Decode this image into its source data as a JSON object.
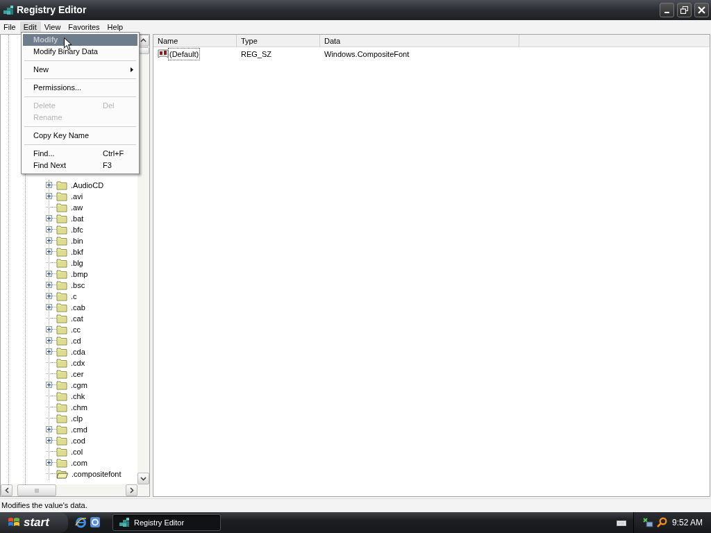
{
  "window": {
    "title": "Registry Editor"
  },
  "menu_bar": [
    {
      "label": "File",
      "open": false
    },
    {
      "label": "Edit",
      "open": true
    },
    {
      "label": "View",
      "open": false
    },
    {
      "label": "Favorites",
      "open": false
    },
    {
      "label": "Help",
      "open": false
    }
  ],
  "edit_menu": [
    {
      "kind": "item",
      "label": "Modify",
      "default": true,
      "disabled": true,
      "selected": true,
      "submenu": false
    },
    {
      "kind": "item",
      "label": "Modify Binary Data",
      "default": false,
      "disabled": false,
      "selected": false,
      "submenu": false
    },
    {
      "kind": "separator"
    },
    {
      "kind": "item",
      "label": "New",
      "default": false,
      "disabled": false,
      "selected": false,
      "submenu": true
    },
    {
      "kind": "separator"
    },
    {
      "kind": "item",
      "label": "Permissions...",
      "default": false,
      "disabled": false,
      "selected": false,
      "submenu": false
    },
    {
      "kind": "separator"
    },
    {
      "kind": "item",
      "label": "Delete",
      "shortcut": "Del",
      "default": false,
      "disabled": true,
      "selected": false,
      "submenu": false
    },
    {
      "kind": "item",
      "label": "Rename",
      "default": false,
      "disabled": true,
      "selected": false,
      "submenu": false
    },
    {
      "kind": "separator"
    },
    {
      "kind": "item",
      "label": "Copy Key Name",
      "default": false,
      "disabled": false,
      "selected": false,
      "submenu": false
    },
    {
      "kind": "separator"
    },
    {
      "kind": "item",
      "label": "Find...",
      "shortcut": "Ctrl+F",
      "default": false,
      "disabled": false,
      "selected": false,
      "submenu": false
    },
    {
      "kind": "item",
      "label": "Find Next",
      "shortcut": "F3",
      "default": false,
      "disabled": false,
      "selected": false,
      "submenu": false
    }
  ],
  "tree": {
    "items": [
      {
        "label": ".AudioCD",
        "expandable": true,
        "selected": false
      },
      {
        "label": ".avi",
        "expandable": true,
        "selected": false
      },
      {
        "label": ".aw",
        "expandable": false,
        "selected": false
      },
      {
        "label": ".bat",
        "expandable": true,
        "selected": false
      },
      {
        "label": ".bfc",
        "expandable": true,
        "selected": false
      },
      {
        "label": ".bin",
        "expandable": true,
        "selected": false
      },
      {
        "label": ".bkf",
        "expandable": true,
        "selected": false
      },
      {
        "label": ".blg",
        "expandable": false,
        "selected": false
      },
      {
        "label": ".bmp",
        "expandable": true,
        "selected": false
      },
      {
        "label": ".bsc",
        "expandable": true,
        "selected": false
      },
      {
        "label": ".c",
        "expandable": true,
        "selected": false
      },
      {
        "label": ".cab",
        "expandable": true,
        "selected": false
      },
      {
        "label": ".cat",
        "expandable": false,
        "selected": false
      },
      {
        "label": ".cc",
        "expandable": true,
        "selected": false
      },
      {
        "label": ".cd",
        "expandable": true,
        "selected": false
      },
      {
        "label": ".cda",
        "expandable": true,
        "selected": false
      },
      {
        "label": ".cdx",
        "expandable": false,
        "selected": false
      },
      {
        "label": ".cer",
        "expandable": false,
        "selected": false
      },
      {
        "label": ".cgm",
        "expandable": true,
        "selected": false
      },
      {
        "label": ".chk",
        "expandable": false,
        "selected": false
      },
      {
        "label": ".chm",
        "expandable": false,
        "selected": false
      },
      {
        "label": ".clp",
        "expandable": false,
        "selected": false
      },
      {
        "label": ".cmd",
        "expandable": true,
        "selected": false
      },
      {
        "label": ".cod",
        "expandable": true,
        "selected": false
      },
      {
        "label": ".col",
        "expandable": false,
        "selected": false
      },
      {
        "label": ".com",
        "expandable": true,
        "selected": false
      },
      {
        "label": ".compositefont",
        "expandable": false,
        "selected": true
      }
    ]
  },
  "values": {
    "columns": [
      "Name",
      "Type",
      "Data"
    ],
    "rows": [
      {
        "name": "(Default)",
        "type": "REG_SZ",
        "data": "Windows.CompositeFont",
        "focused": true
      }
    ]
  },
  "status_bar": "Modifies the value's data.",
  "taskbar": {
    "start": "start",
    "tasks": [
      {
        "label": "Registry Editor",
        "active": true
      }
    ],
    "clock": "9:52 AM"
  }
}
